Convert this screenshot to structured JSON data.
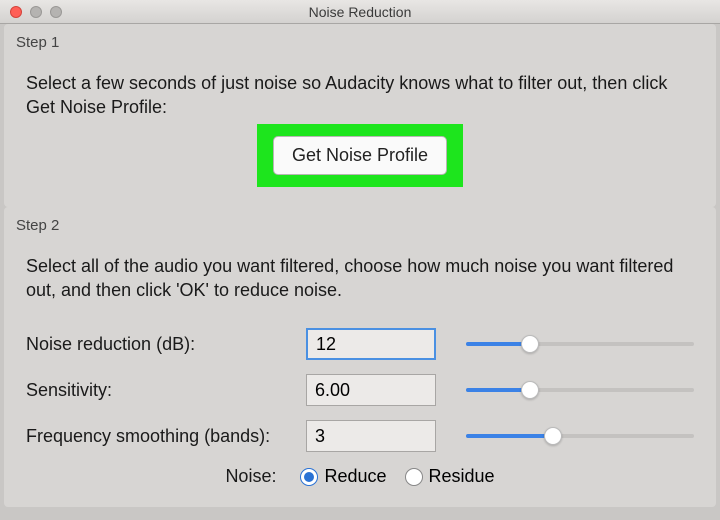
{
  "window": {
    "title": "Noise Reduction"
  },
  "step1": {
    "label": "Step 1",
    "instruction": "Select a few seconds of just noise so Audacity knows what to filter out, then click Get Noise Profile:",
    "button_label": "Get Noise Profile"
  },
  "step2": {
    "label": "Step 2",
    "instruction": "Select all of the audio you want filtered, choose how much noise you want filtered out, and then click 'OK' to reduce noise.",
    "noise_reduction": {
      "label": "Noise reduction (dB):",
      "value": "12",
      "slider_pct": 28
    },
    "sensitivity": {
      "label": "Sensitivity:",
      "value": "6.00",
      "slider_pct": 28
    },
    "freq_smoothing": {
      "label": "Frequency smoothing (bands):",
      "value": "3",
      "slider_pct": 38
    },
    "noise_radio": {
      "label": "Noise:",
      "reduce": "Reduce",
      "residue": "Residue",
      "selected": "reduce"
    }
  }
}
